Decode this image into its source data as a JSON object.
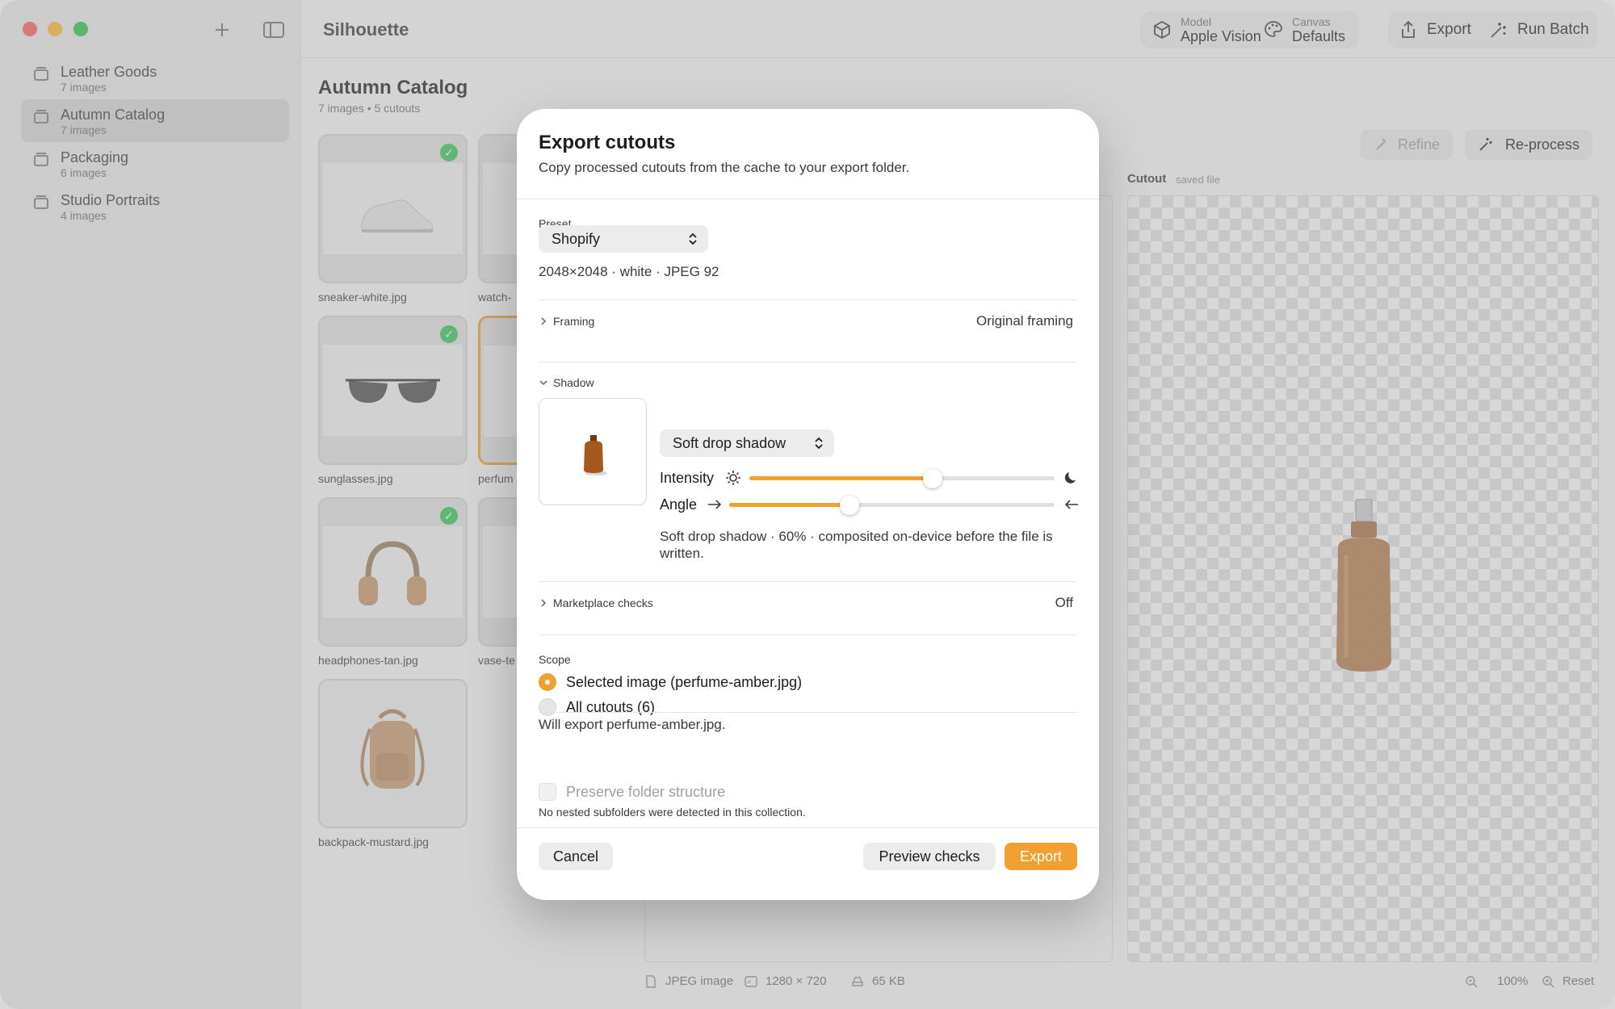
{
  "app": {
    "title": "Silhouette"
  },
  "sidebar": {
    "collections": [
      {
        "name": "Leather Goods",
        "count": "7 images"
      },
      {
        "name": "Autumn Catalog",
        "count": "7 images"
      },
      {
        "name": "Packaging",
        "count": "6 images"
      },
      {
        "name": "Studio Portraits",
        "count": "4 images"
      }
    ]
  },
  "toolbar": {
    "model_label": "Model",
    "model_value": "Apple Vision",
    "canvas_label": "Canvas",
    "canvas_value": "Defaults",
    "export_label": "Export",
    "run_batch_label": "Run Batch"
  },
  "catalog": {
    "title": "Autumn Catalog",
    "subtitle": "7 images • 5 cutouts",
    "images": [
      {
        "name": "sneaker-white.jpg"
      },
      {
        "name": "watch-"
      },
      {
        "name": "sunglasses.jpg"
      },
      {
        "name": "perfum"
      },
      {
        "name": "headphones-tan.jpg"
      },
      {
        "name": "vase-te"
      },
      {
        "name": "backpack-mustard.jpg"
      }
    ]
  },
  "detail": {
    "refine_label": "Refine",
    "reprocess_label": "Re-process",
    "cutout_label": "Cutout",
    "cutout_hint": "saved file",
    "status": {
      "type": "JPEG image",
      "dimensions": "1280 × 720",
      "size": "65 KB",
      "zoom": "100%",
      "reset": "Reset"
    }
  },
  "dialog": {
    "title": "Export cutouts",
    "subtitle": "Copy processed cutouts from the cache to your export folder.",
    "preset_label": "Preset",
    "preset_value": "Shopify",
    "preset_meta": "2048×2048 · white · JPEG 92",
    "framing_label": "Framing",
    "framing_value": "Original framing",
    "shadow_label": "Shadow",
    "shadow_style": "Soft drop shadow",
    "intensity_label": "Intensity",
    "intensity_value": 0.6,
    "angle_label": "Angle",
    "angle_value": 0.37,
    "shadow_desc": "Soft drop shadow · 60% · composited on-device before the file is written.",
    "marketplace_label": "Marketplace checks",
    "marketplace_value": "Off",
    "scope_label": "Scope",
    "scope_selected": "Selected image (perfume-amber.jpg)",
    "scope_all": "All cutouts (6)",
    "scope_note": "Will export perfume-amber.jpg.",
    "preserve_label": "Preserve folder structure",
    "preserve_note": "No nested subfolders were detected in this collection.",
    "cancel_label": "Cancel",
    "preview_label": "Preview checks",
    "export_label": "Export"
  },
  "colors": {
    "accent": "#f0a030",
    "check": "#34c759"
  }
}
